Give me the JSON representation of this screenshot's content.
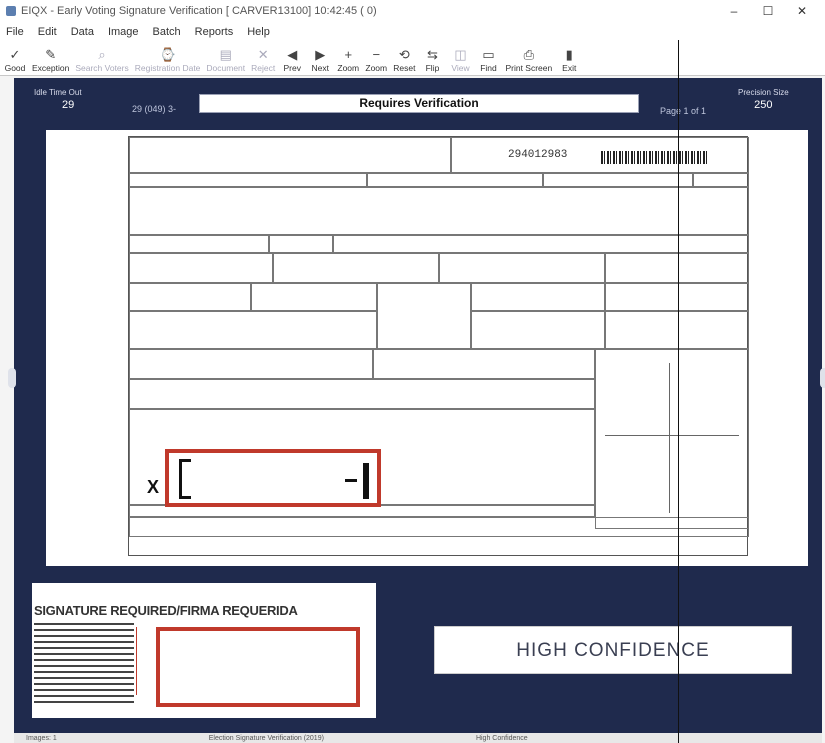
{
  "window": {
    "title": "EIQX - Early Voting Signature Verification [ CARVER13100] 10:42:45 ( 0)",
    "controls": [
      "–",
      "☐",
      "✕"
    ]
  },
  "menu": [
    "File",
    "Edit",
    "Data",
    "Image",
    "Batch",
    "Reports",
    "Help"
  ],
  "toolbar": [
    {
      "icon": "check-icon",
      "glyph": "✓",
      "label": "Good",
      "enabled": true
    },
    {
      "icon": "exception-icon",
      "glyph": "✎",
      "label": "Exception",
      "enabled": true
    },
    {
      "icon": "search-voter-icon",
      "glyph": "⌕",
      "label": "Search Voters",
      "enabled": false
    },
    {
      "icon": "history-icon",
      "glyph": "⌚",
      "label": "Registration Date",
      "enabled": false
    },
    {
      "icon": "document-icon",
      "glyph": "▤",
      "label": "Document",
      "enabled": false
    },
    {
      "icon": "reject-icon",
      "glyph": "✕",
      "label": "Reject",
      "enabled": false
    },
    {
      "icon": "prev-icon",
      "glyph": "◀",
      "label": "Prev",
      "enabled": true
    },
    {
      "icon": "next-icon",
      "glyph": "▶",
      "label": "Next",
      "enabled": true
    },
    {
      "icon": "zoom-in-icon",
      "glyph": "+",
      "label": "Zoom",
      "enabled": true
    },
    {
      "icon": "zoom-out-icon",
      "glyph": "−",
      "label": "Zoom",
      "enabled": true
    },
    {
      "icon": "reset-icon",
      "glyph": "⟲",
      "label": "Reset",
      "enabled": true
    },
    {
      "icon": "flip-icon",
      "glyph": "⇆",
      "label": "Flip",
      "enabled": true
    },
    {
      "icon": "view-icon",
      "glyph": "◫",
      "label": "View",
      "enabled": false
    },
    {
      "icon": "find-icon",
      "glyph": "▭",
      "label": "Find",
      "enabled": true
    },
    {
      "icon": "print-screen-icon",
      "glyph": "⎙",
      "label": "Print Screen",
      "enabled": true
    },
    {
      "icon": "exit-icon",
      "glyph": "▮",
      "label": "Exit",
      "enabled": true
    }
  ],
  "header": {
    "idle_label": "Idle Time Out",
    "idle_value": "29",
    "record_id": "29 (049) 3-",
    "banner": "Requires Verification",
    "page": "Page 1 of 1",
    "precision_label": "Precision Size",
    "precision_value": "250"
  },
  "form": {
    "number": "294012983",
    "x_mark": "X"
  },
  "signature_panel": {
    "title": "SIGNATURE REQUIRED/FIRMA REQUERIDA"
  },
  "confidence": "HIGH CONFIDENCE",
  "status": {
    "left": "Images: 1",
    "middle": "Election Signature Verification (2019)",
    "right": "High Confidence"
  }
}
